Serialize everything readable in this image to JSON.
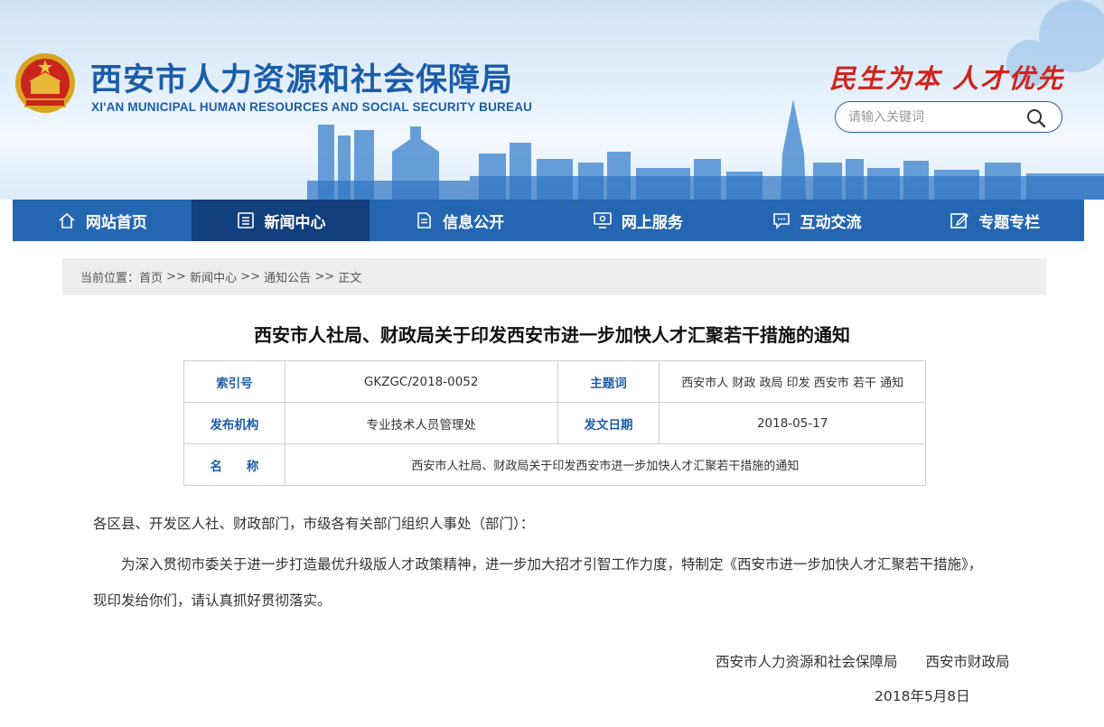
{
  "header": {
    "title": "西安市人力资源和社会保障局",
    "subtitle": "XI'AN MUNICIPAL HUMAN RESOURCES AND SOCIAL SECURITY BUREAU",
    "slogan": "民生为本 人才优先",
    "search_placeholder": "请输入关键词"
  },
  "nav": {
    "items": [
      {
        "label": "网站首页",
        "icon": "home-icon"
      },
      {
        "label": "新闻中心",
        "icon": "news-icon"
      },
      {
        "label": "信息公开",
        "icon": "document-icon"
      },
      {
        "label": "网上服务",
        "icon": "monitor-icon"
      },
      {
        "label": "互动交流",
        "icon": "chat-icon"
      },
      {
        "label": "专题专栏",
        "icon": "edit-icon"
      }
    ],
    "active_index": 1
  },
  "breadcrumb": {
    "prefix": "当前位置：",
    "items": [
      "首页",
      "新闻中心",
      "通知公告",
      "正文"
    ],
    "separator": " >> "
  },
  "article": {
    "title": "西安市人社局、财政局关于印发西安市进一步加快人才汇聚若干措施的通知",
    "meta": {
      "index_label": "索引号",
      "index_value": "GKZGC/2018-0052",
      "subject_label": "主题词",
      "subject_value": "西安市人 财政 政局 印发 西安市 若干 通知",
      "org_label": "发布机构",
      "org_value": "专业技术人员管理处",
      "date_label": "发文日期",
      "date_value": "2018-05-17",
      "name_label": "名　　称",
      "name_value": "西安市人社局、财政局关于印发西安市进一步加快人才汇聚若干措施的通知"
    },
    "salutation": "各区县、开发区人社、财政部门，市级各有关部门组织人事处（部门）：",
    "paragraph": "为深入贯彻市委关于进一步打造最优升级版人才政策精神，进一步加大招才引智工作力度，特制定《西安市进一步加快人才汇聚若干措施》，现印发给你们，请认真抓好贯彻落实。",
    "signatories": [
      "西安市人力资源和社会保障局",
      "西安市财政局"
    ],
    "date": "2018年5月8日"
  },
  "colors": {
    "brand_blue": "#1c5da8",
    "nav_bg": "#2566b2",
    "nav_active": "#123f7d",
    "slogan_red": "#d1241d"
  }
}
